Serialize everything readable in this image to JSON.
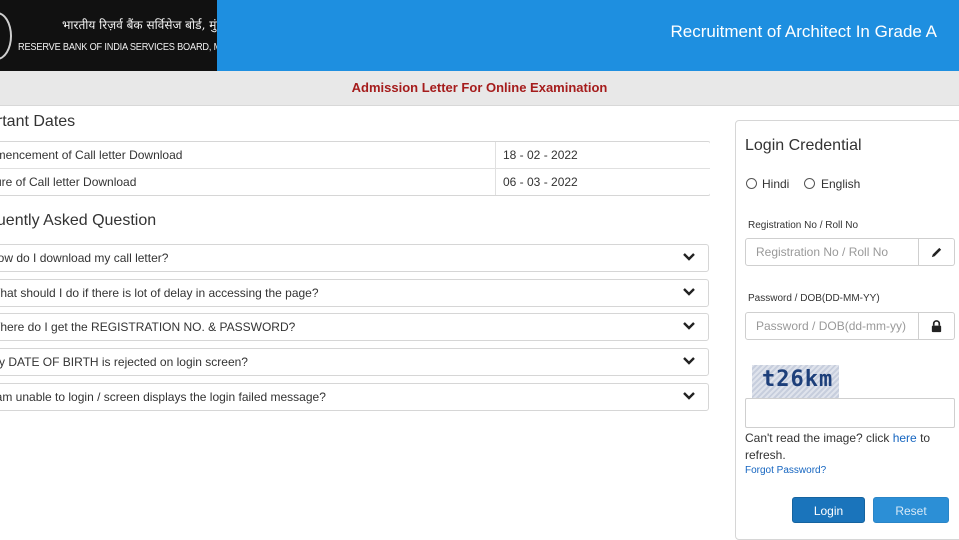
{
  "header": {
    "logo_hindi": "भारतीय रिज़र्व बैंक सर्विसेज बोर्ड, मुंबई",
    "logo_english": "RESERVE BANK OF INDIA SERVICES BOARD, MUMBAI",
    "title": "Recruitment of Architect In Grade A"
  },
  "subheader": {
    "text": "Admission Letter For Online Examination"
  },
  "important_dates": {
    "title": "ortant Dates",
    "rows": [
      {
        "label": "nmencement of Call letter Download",
        "value": "18 - 02 - 2022"
      },
      {
        "label": "sure of Call letter Download",
        "value": "06 - 03 - 2022"
      }
    ]
  },
  "faq": {
    "title": "quently Asked Question",
    "items": [
      "How do I download my call letter?",
      "What should I do if there is lot of delay in accessing the page?",
      "Where do I get the REGISTRATION NO. & PASSWORD?",
      "My DATE OF BIRTH is rejected on login screen?",
      "I am unable to login / screen displays the login failed message?"
    ]
  },
  "login": {
    "title": "Login Credential",
    "lang_hindi": "Hindi",
    "lang_english": "English",
    "reg_label": "Registration No / Roll No",
    "reg_placeholder": "Registration No / Roll No",
    "pwd_label": "Password / DOB(DD-MM-YY)",
    "pwd_placeholder": "Password / DOB(dd-mm-yy)",
    "captcha_text": "t26km",
    "cant_read_prefix": "Can't read the image? click ",
    "cant_read_link": "here",
    "cant_read_suffix": " to refresh.",
    "forgot": "Forgot Password?",
    "login_btn": "Login",
    "reset_btn": "Reset"
  },
  "colors": {
    "header_blue": "#1e8fe0",
    "subheader_text": "#a51c1c",
    "login_button": "#1a74bb",
    "reset_button": "#2c8fd6",
    "link": "#1565c0"
  },
  "icons": {
    "reg_addon": "pencil-icon",
    "pwd_addon": "lock-icon",
    "faq_toggle": "chevron-down-icon"
  }
}
